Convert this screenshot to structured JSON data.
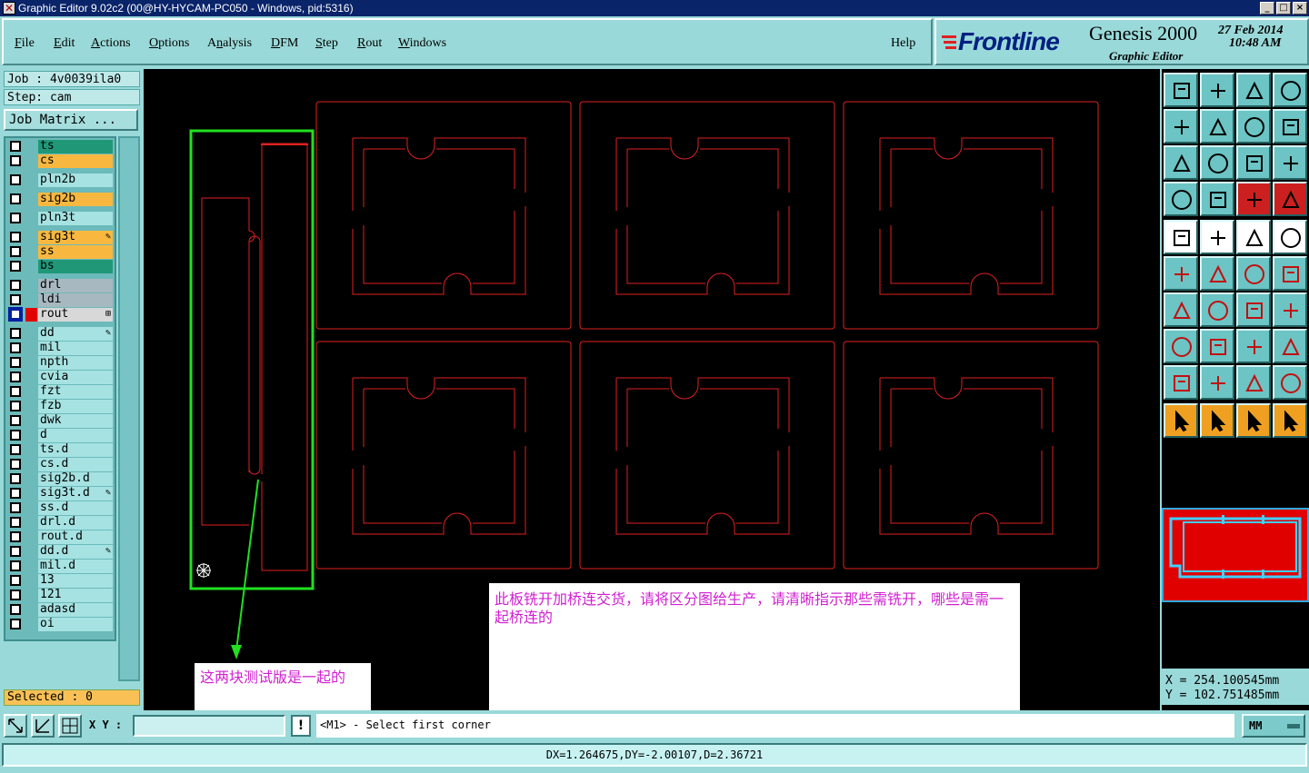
{
  "window": {
    "title": "Graphic Editor 9.02c2 (00@HY-HYCAM-PC050 - Windows, pid:5316)",
    "controls": [
      "_",
      "□",
      "×"
    ]
  },
  "menu": {
    "items": [
      {
        "label": "File",
        "mnemonic": "F"
      },
      {
        "label": "Edit",
        "mnemonic": "E"
      },
      {
        "label": "Actions",
        "mnemonic": "A"
      },
      {
        "label": "Options",
        "mnemonic": "O"
      },
      {
        "label": "Analysis",
        "mnemonic": "n"
      },
      {
        "label": "DFM",
        "mnemonic": "D"
      },
      {
        "label": "Step",
        "mnemonic": "S"
      },
      {
        "label": "Rout",
        "mnemonic": "R"
      },
      {
        "label": "Windows",
        "mnemonic": "W"
      }
    ],
    "help": "Help"
  },
  "brand": {
    "logo": "Frontline",
    "product": "Genesis 2000",
    "subtitle": "Graphic Editor",
    "date": "27 Feb 2014",
    "time": "10:48 AM"
  },
  "job": {
    "job_label": "Job : 4v0039ila0",
    "step_label": "Step: cam",
    "matrix_button": "Job Matrix ..."
  },
  "layers": [
    {
      "name": "ts",
      "color": "#209878",
      "group": 0
    },
    {
      "name": "cs",
      "color": "#f8b840",
      "group": 0
    },
    {
      "name": "pln2b",
      "color": "#a6e2e2",
      "group": 1
    },
    {
      "name": "sig2b",
      "color": "#f8b840",
      "group": 2
    },
    {
      "name": "pln3t",
      "color": "#a6e2e2",
      "group": 3
    },
    {
      "name": "sig3t",
      "color": "#f8b840",
      "group": 4,
      "mark": "pencil"
    },
    {
      "name": "ss",
      "color": "#f8b840",
      "group": 4
    },
    {
      "name": "bs",
      "color": "#209878",
      "group": 4
    },
    {
      "name": "drl",
      "color": "#a8b8c0",
      "group": 5
    },
    {
      "name": "ldi",
      "color": "#a8b8c0",
      "group": 5
    },
    {
      "name": "rout",
      "color": "#d8d8d8",
      "group": 5,
      "active": true,
      "mark": "grid"
    },
    {
      "name": "dd",
      "color": "#a6e2e2",
      "group": 6,
      "mark": "pencil"
    },
    {
      "name": "mil",
      "color": "#a6e2e2",
      "group": 6
    },
    {
      "name": "npth",
      "color": "#a6e2e2",
      "group": 6
    },
    {
      "name": "cvia",
      "color": "#a6e2e2",
      "group": 6
    },
    {
      "name": "fzt",
      "color": "#a6e2e2",
      "group": 6
    },
    {
      "name": "fzb",
      "color": "#a6e2e2",
      "group": 6
    },
    {
      "name": "dwk",
      "color": "#a6e2e2",
      "group": 6
    },
    {
      "name": "d",
      "color": "#a6e2e2",
      "group": 6
    },
    {
      "name": "ts.d",
      "color": "#a6e2e2",
      "group": 6
    },
    {
      "name": "cs.d",
      "color": "#a6e2e2",
      "group": 6
    },
    {
      "name": "sig2b.d",
      "color": "#a6e2e2",
      "group": 6
    },
    {
      "name": "sig3t.d",
      "color": "#a6e2e2",
      "group": 6,
      "mark": "pencil"
    },
    {
      "name": "ss.d",
      "color": "#a6e2e2",
      "group": 6
    },
    {
      "name": "drl.d",
      "color": "#a6e2e2",
      "group": 6
    },
    {
      "name": "rout.d",
      "color": "#a6e2e2",
      "group": 6
    },
    {
      "name": "dd.d",
      "color": "#a6e2e2",
      "group": 6,
      "mark": "pencil"
    },
    {
      "name": "mil.d",
      "color": "#a6e2e2",
      "group": 6
    },
    {
      "name": "13",
      "color": "#a6e2e2",
      "group": 6
    },
    {
      "name": "121",
      "color": "#a6e2e2",
      "group": 6
    },
    {
      "name": "adasd",
      "color": "#a6e2e2",
      "group": 6
    },
    {
      "name": "oi",
      "color": "#a6e2e2",
      "group": 6
    }
  ],
  "selected": "Selected : 0",
  "annotations": {
    "note_main": "此板铣开加桥连交货，请将区分图给生产，请清晰指示那些需铣开，哪些是需一起桥连的",
    "note_test": "这两块测试版是一起的"
  },
  "coords": {
    "x": "X  = 254.100545mm",
    "y": "Y  = 102.751485mm"
  },
  "command": {
    "xy_label": "X Y :",
    "xy_value": "",
    "prompt": "<M1> - Select first corner",
    "units": "MM"
  },
  "status": "DX=1.264675,DY=-2.00107,D=2.36721",
  "colors": {
    "board_outline": "#e02020",
    "selection": "#20e020",
    "background": "#9ad9d9"
  }
}
